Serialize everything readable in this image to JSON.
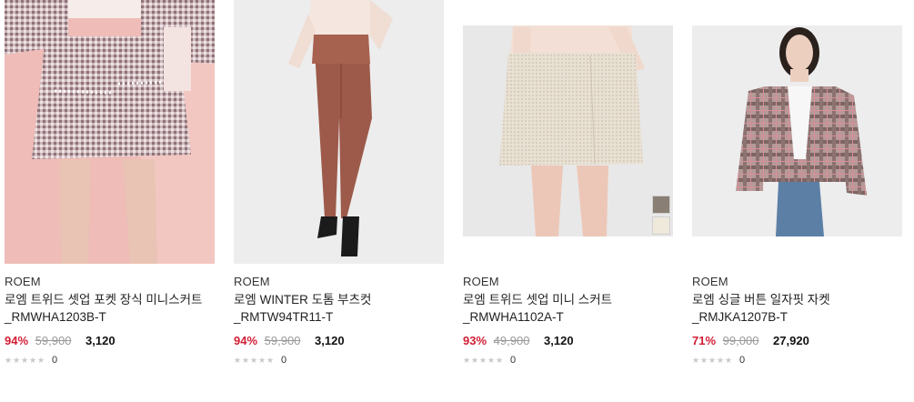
{
  "products": [
    {
      "brand": "ROEM",
      "name_line1": "로엠 트위드 셋업 포켓 장식 미니스커트",
      "name_line2": "_RMWHA1203B-T",
      "discount": "94%",
      "original_price": "59,900",
      "sale_price": "3,120",
      "review_count": "0",
      "image_label": "tweed-mini-skirt-photo"
    },
    {
      "brand": "ROEM",
      "name_line1": "로엠 WINTER 도톰 부츠컷",
      "name_line2": "_RMTW94TR11-T",
      "discount": "94%",
      "original_price": "59,900",
      "sale_price": "3,120",
      "review_count": "0",
      "image_label": "bootcut-pants-photo"
    },
    {
      "brand": "ROEM",
      "name_line1": "로엠 트위드 셋업 미니 스커트",
      "name_line2": "_RMWHA1102A-T",
      "discount": "93%",
      "original_price": "49,900",
      "sale_price": "3,120",
      "review_count": "0",
      "image_label": "tweed-mini-skirt-photo",
      "swatch_colors": [
        "#8a7f74",
        "#efe9dc"
      ]
    },
    {
      "brand": "ROEM",
      "name_line1": "로엠 싱글 버튼 일자핏 자켓",
      "name_line2": "_RMJKA1207B-T",
      "discount": "71%",
      "original_price": "99,000",
      "sale_price": "27,920",
      "review_count": "0",
      "image_label": "check-jacket-photo"
    }
  ],
  "colors": {
    "discount": "#d11d34",
    "star_empty": "#c9c9c9"
  }
}
